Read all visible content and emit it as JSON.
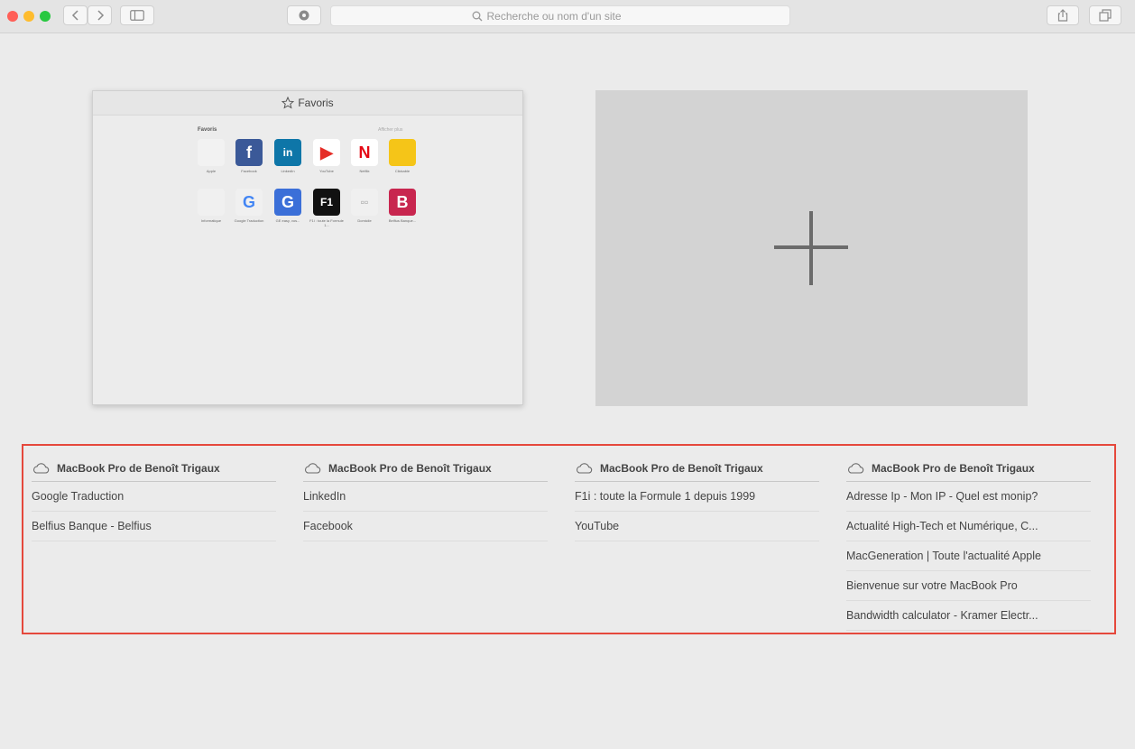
{
  "toolbar": {
    "traffic_lights": {
      "close": "#ff5f57",
      "minimize": "#febc2e",
      "zoom": "#28c840"
    },
    "icons": {
      "back": "chevron-left-icon",
      "forward": "chevron-right-icon",
      "sidebar": "sidebar-icon",
      "privacy": "privacy-shield-icon",
      "share": "share-icon",
      "tabs": "tab-overview-icon"
    },
    "search_placeholder": "Recherche ou nom d'un site"
  },
  "favorites_preview": {
    "title": "Favoris",
    "inner_title": "Favoris",
    "inner_show_all": "Afficher plus",
    "tiles": [
      {
        "glyph": "",
        "label": "Apple",
        "bg": "#f2f2f2",
        "color": "#555"
      },
      {
        "glyph": "f",
        "label": "Facebook",
        "bg": "#3b5998",
        "color": "#ffffff"
      },
      {
        "glyph": "in",
        "label": "LinkedIn",
        "bg": "#0e76a8",
        "color": "#ffffff"
      },
      {
        "glyph": "▶",
        "label": "YouTube",
        "bg": "#ffffff",
        "color": "#e52d27"
      },
      {
        "glyph": "N",
        "label": "Netflix",
        "bg": "#ffffff",
        "color": "#e50914"
      },
      {
        "glyph": "",
        "label": "Clickable",
        "bg": "#f5c518",
        "color": "#333"
      },
      {
        "glyph": "",
        "label": "Informatique",
        "bg": "#f0f0f0",
        "color": "#666"
      },
      {
        "glyph": "G",
        "label": "Google Traduction",
        "bg": "#f0f0f0",
        "color": "#4285f4"
      },
      {
        "glyph": "G",
        "label": "GE easy, vos...",
        "bg": "#3b6fd8",
        "color": "#ffffff"
      },
      {
        "glyph": "F1",
        "label": "F1i : toute la Formule 1...",
        "bg": "#111111",
        "color": "#ffffff"
      },
      {
        "glyph": "▫▫",
        "label": "Domicile",
        "bg": "#f0f0f0",
        "color": "#999"
      },
      {
        "glyph": "B",
        "label": "Belfius Banque...",
        "bg": "#c8264f",
        "color": "#ffffff"
      }
    ]
  },
  "new_tab_icon": "plus-icon",
  "icloud_tabs": [
    {
      "device": "MacBook Pro de Benoît Trigaux",
      "links": [
        "Google Traduction",
        "Belfius Banque - Belfius"
      ]
    },
    {
      "device": "MacBook Pro de Benoît Trigaux",
      "links": [
        "LinkedIn",
        "Facebook"
      ]
    },
    {
      "device": "MacBook Pro de Benoît Trigaux",
      "links": [
        "F1i : toute la Formule 1 depuis 1999",
        "YouTube"
      ]
    },
    {
      "device": "MacBook Pro de Benoît Trigaux",
      "links": [
        "Adresse Ip - Mon IP - Quel est monip?",
        "Actualité High-Tech et Numérique, C...",
        "MacGeneration | Toute l'actualité Apple",
        "Bienvenue sur votre MacBook Pro",
        "Bandwidth calculator - Kramer Electr..."
      ]
    }
  ],
  "highlight_color": "#e5483c"
}
